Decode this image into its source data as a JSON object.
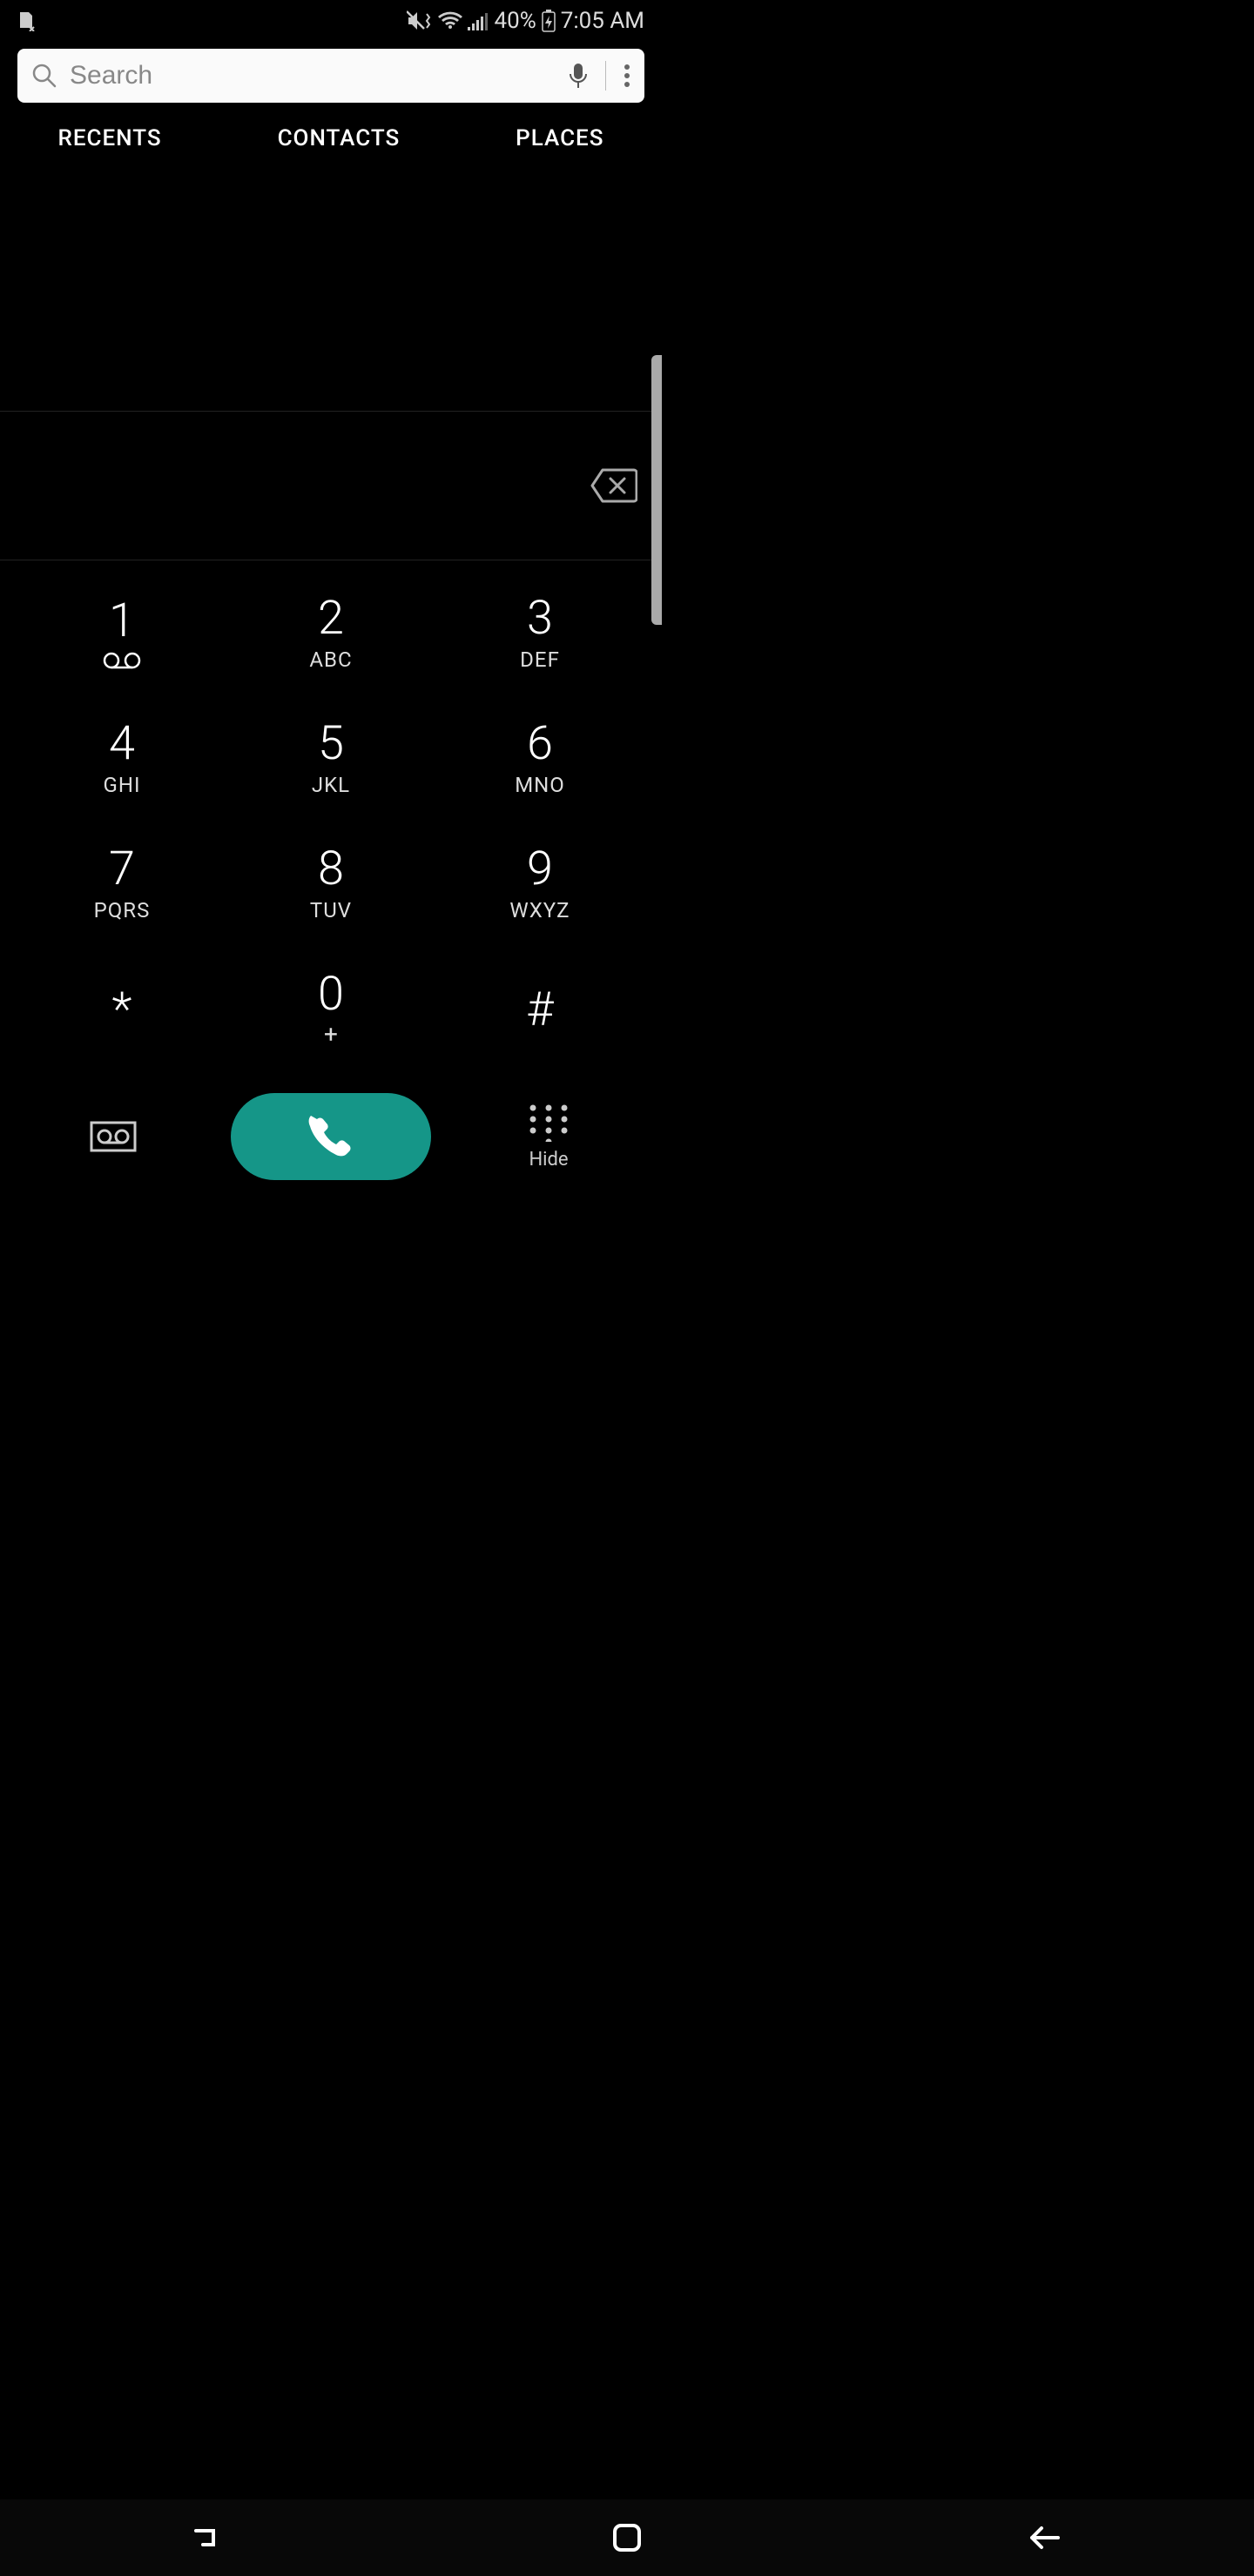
{
  "status": {
    "battery": "40%",
    "time": "7:05 AM"
  },
  "search": {
    "placeholder": "Search"
  },
  "tabs": [
    "RECENTS",
    "CONTACTS",
    "PLACES"
  ],
  "keypad": [
    [
      {
        "digit": "1",
        "letters": "",
        "voicemail": true
      },
      {
        "digit": "2",
        "letters": "ABC"
      },
      {
        "digit": "3",
        "letters": "DEF"
      }
    ],
    [
      {
        "digit": "4",
        "letters": "GHI"
      },
      {
        "digit": "5",
        "letters": "JKL"
      },
      {
        "digit": "6",
        "letters": "MNO"
      }
    ],
    [
      {
        "digit": "7",
        "letters": "PQRS"
      },
      {
        "digit": "8",
        "letters": "TUV"
      },
      {
        "digit": "9",
        "letters": "WXYZ"
      }
    ],
    [
      {
        "digit": "*",
        "letters": "",
        "symbol": true
      },
      {
        "digit": "0",
        "letters": "+"
      },
      {
        "digit": "#",
        "letters": "",
        "symbol": true
      }
    ]
  ],
  "actions": {
    "hide_label": "Hide"
  }
}
